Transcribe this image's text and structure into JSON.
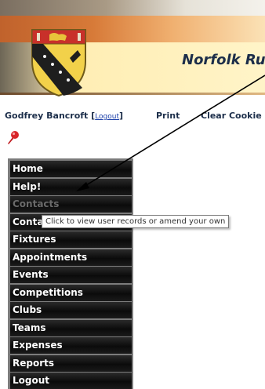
{
  "header": {
    "title": "Norfolk Ru"
  },
  "userbar": {
    "user_name": "Godfrey Bancroft",
    "logout_label": "Logout",
    "print_label": "Print",
    "clear_label": "Clear Cookie"
  },
  "menu": {
    "items": [
      {
        "label": "Home"
      },
      {
        "label": "Help!"
      },
      {
        "label": "Contacts"
      },
      {
        "label": "Conta"
      },
      {
        "label": "Fixtures"
      },
      {
        "label": "Appointments"
      },
      {
        "label": "Events"
      },
      {
        "label": "Competitions"
      },
      {
        "label": "Clubs"
      },
      {
        "label": "Teams"
      },
      {
        "label": "Expenses"
      },
      {
        "label": "Reports"
      },
      {
        "label": "Logout"
      }
    ]
  },
  "tooltip": {
    "text": "Click to view user records or amend your own"
  },
  "colors": {
    "menu_bg": "#0b0b0b",
    "menu_text": "#ffffff",
    "menu_text_dim": "#6a6a6a",
    "title_color": "#1c2e4a",
    "link_color": "#1a3ea8"
  },
  "icons": {
    "crest": "norfolk-crest-icon",
    "pin": "pushpin-icon"
  }
}
